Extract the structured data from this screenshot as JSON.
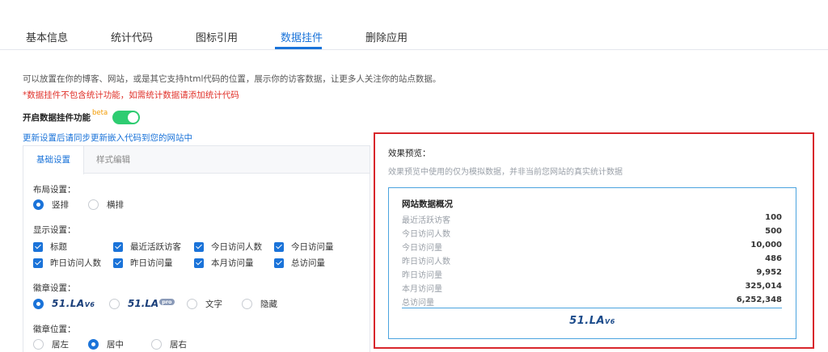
{
  "tabs": [
    "基本信息",
    "统计代码",
    "图标引用",
    "数据挂件",
    "删除应用"
  ],
  "description": "可以放置在你的博客、网站，或是其它支持html代码的位置，展示你的访客数据，让更多人关注你的站点数据。",
  "warning": "*数据挂件不包含统计功能，如需统计数据请添加统计代码",
  "enable": {
    "label": "开启数据挂件功能",
    "beta": "beta",
    "on": true
  },
  "sync_link": "更新设置后请同步更新嵌入代码到您的网站中",
  "settings": {
    "tabs": [
      "基础设置",
      "样式编辑"
    ],
    "layout": {
      "title": "布局设置：",
      "options": [
        "竖排",
        "横排"
      ],
      "selected": "竖排"
    },
    "display": {
      "title": "显示设置：",
      "items": [
        "标题",
        "最近活跃访客",
        "今日访问人数",
        "今日访问量",
        "昨日访问人数",
        "昨日访问量",
        "本月访问量",
        "总访问量"
      ]
    },
    "badge": {
      "title": "徽章设置：",
      "logo_v6": "51.LA",
      "logo_v6_suffix": "V6",
      "logo_pro": "51.LA",
      "pro_badge": "pro",
      "text_option": "文字",
      "hide_option": "隐藏"
    },
    "position": {
      "title": "徽章位置：",
      "options": [
        "居左",
        "居中",
        "居右"
      ],
      "selected": "居中"
    }
  },
  "preview": {
    "title": "效果预览：",
    "desc": "效果预览中使用的仅为模拟数据，并非当前您网站的真实统计数据",
    "card_title": "网站数据概况",
    "stats": [
      {
        "label": "最近活跃访客",
        "value": "100"
      },
      {
        "label": "今日访问人数",
        "value": "500"
      },
      {
        "label": "今日访问量",
        "value": "10,000"
      },
      {
        "label": "昨日访问人数",
        "value": "486"
      },
      {
        "label": "昨日访问量",
        "value": "9,952"
      },
      {
        "label": "本月访问量",
        "value": "325,014"
      },
      {
        "label": "总访问量",
        "value": "6,252,348"
      }
    ],
    "logo": "51.LA",
    "logo_suffix": "V6"
  },
  "colors": {
    "accent": "#1a73d9",
    "toggle": "#2ecc71",
    "warning": "#e0322b",
    "highlight": "#d8262b"
  }
}
